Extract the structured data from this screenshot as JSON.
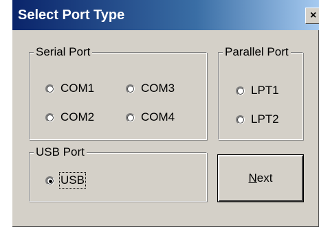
{
  "window": {
    "title": "Select Port Type",
    "close_glyph": "×"
  },
  "serial": {
    "label": "Serial Port",
    "options": [
      {
        "label": "COM1",
        "checked": false
      },
      {
        "label": "COM3",
        "checked": false
      },
      {
        "label": "COM2",
        "checked": false
      },
      {
        "label": "COM4",
        "checked": false
      }
    ]
  },
  "parallel": {
    "label": "Parallel Port",
    "options": [
      {
        "label": "LPT1",
        "checked": false
      },
      {
        "label": "LPT2",
        "checked": false
      }
    ]
  },
  "usb": {
    "label": "USB Port",
    "options": [
      {
        "label": "USB",
        "checked": true
      }
    ]
  },
  "next_button": {
    "accel": "N",
    "rest": "ext"
  },
  "colors": {
    "title_start": "#0a246a",
    "title_end": "#a6caf0",
    "face": "#d4d0c8"
  }
}
